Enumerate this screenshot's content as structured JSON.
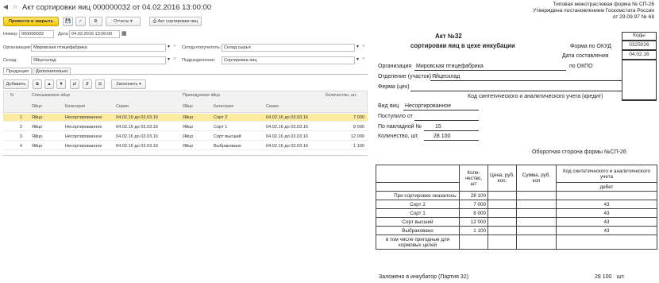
{
  "window": {
    "title": "Акт сортировки яиц 000000032 от 04.02.2016 13:00:00"
  },
  "toolbar": {
    "post_close": "Провести и закрыть",
    "reports": "Отчеты",
    "act_button": "Акт сортировки яиц"
  },
  "header": {
    "number_label": "Номер:",
    "number_value": "000000032",
    "date_label": "Дата:",
    "date_value": "04.02.2016 13:00:00",
    "org_label": "Организация:",
    "org_value": "Мировская птицефабрика",
    "warehouse_label": "Склад:",
    "warehouse_value": "Яйцесклад",
    "recv_label": "Склад-получатель:",
    "recv_value": "Склад сырья",
    "dept_label": "Подразделение:",
    "dept_value": "Сортировка яиц"
  },
  "tabs": [
    "Продукция",
    "Дополнительно"
  ],
  "table_toolbar": {
    "add": "Добавить",
    "fill": "Заполнить"
  },
  "grid": {
    "headers": {
      "n": "N",
      "written_off": "Списываемое яйцо",
      "incoming": "Приходуемое яйцо",
      "qty": "Количество, шт.",
      "egg": "Яйцо",
      "category": "Категория",
      "series": "Серия"
    },
    "rows": [
      {
        "n": "1",
        "egg": "Яйцо",
        "category": "Несортированное",
        "series": "04.02.16 до 03.03.16",
        "egg2": "Яйцо",
        "category2": "Сорт 2",
        "series2": "04.02.16 до 03.03.16",
        "qty": "7 000"
      },
      {
        "n": "2",
        "egg": "Яйцо",
        "category": "Несортированное",
        "series": "04.02.16 до 03.03.16",
        "egg2": "Яйцо",
        "category2": "Сорт 1",
        "series2": "04.02.16 до 03.03.16",
        "qty": "8 000"
      },
      {
        "n": "3",
        "egg": "Яйцо",
        "category": "Несортированное",
        "series": "04.02.16 до 03.03.16",
        "egg2": "Яйцо",
        "category2": "Сорт высший",
        "series2": "04.02.16 до 03.03.16",
        "qty": "12 000"
      },
      {
        "n": "4",
        "egg": "Яйцо",
        "category": "Несортированное",
        "series": "04.02.16 до 03.03.16",
        "egg2": "Яйцо",
        "category2": "Выбраковано",
        "series2": "04.02.16 до 03.03.16",
        "qty": "1 100"
      }
    ]
  },
  "form": {
    "line1": "Типовая межотраслевая форма № СП-26",
    "line2": "Утверждена постановлением Госкомстата России",
    "line3": "от 29.09.97 № 68",
    "codes": "Коды",
    "act": "Акт №32",
    "doc_title": "сортировки яиц в цехе инкубации",
    "okud_label": "Форма по ОКУД",
    "okud": "0325026",
    "date_label": "Дата составления",
    "date": "04.02.16",
    "okpo": "по ОКПО",
    "org": "Организация",
    "org_value": "Мировская птицефабрика",
    "dept": "Отделение (участок)",
    "dept_value": "Яйцесклад",
    "farm": "Ферма (цех)",
    "acct": "Код синтетического и аналитического учета (кредит)",
    "egg_type_label": "Вид яиц",
    "egg_type": "Несортированное",
    "from_label": "Поступило от",
    "invoice_label": "По накладной №",
    "invoice": "15",
    "qty_label": "Количество, шт.",
    "qty": "28 100",
    "reverse": "Оборотная сторона формы №СП-26",
    "t_qty": "Коли-чество, шт",
    "t_price": "Цена, руб. коп.",
    "t_sum": "Сумма, руб. коп",
    "t_acct": "Код синтетического и аналитического учета",
    "t_debit": "дебет",
    "found": "При сортировке оказалось:",
    "found_qty": "28 100",
    "items": [
      {
        "name": "Сорт 2",
        "qty": "7 000",
        "code": "43"
      },
      {
        "name": "Сорт 1",
        "qty": "8 000",
        "code": "43"
      },
      {
        "name": "Сорт высший",
        "qty": "12 000",
        "code": "43"
      },
      {
        "name": "Выбраковано",
        "qty": "1 100",
        "code": "43"
      }
    ],
    "suitable": "в том числе пригодные для кормовых целей",
    "incubator": "Заложено в инкубатор (Партия 32)",
    "incubator_qty": "28 100",
    "pcs": "шт."
  }
}
